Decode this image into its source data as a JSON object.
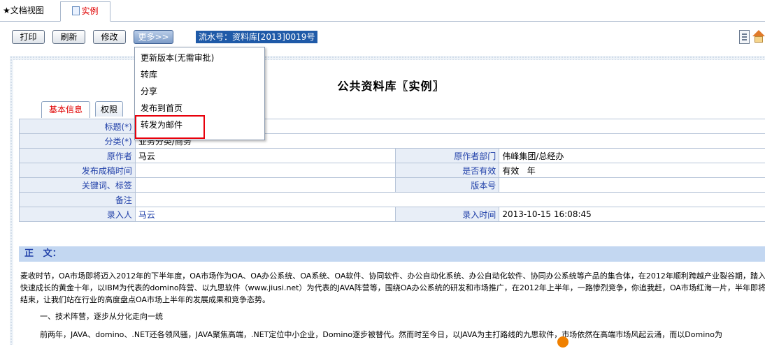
{
  "doc_tabs": {
    "view_label": "★文档视图",
    "example_label": "实例"
  },
  "toolbar": {
    "print_label": "打印",
    "refresh_label": "刷新",
    "edit_label": "修改",
    "more_label": "更多>>",
    "serial_label": "流水号：资料库[2013]0019号"
  },
  "more_menu": {
    "items": [
      "更新版本(无需审批)",
      "转库",
      "分享",
      "发布到首页",
      "转发为邮件"
    ],
    "highlighted": "转发为邮件"
  },
  "page": {
    "title": "公共资料库〖实例〗",
    "tabs": [
      "基本信息",
      "权限"
    ]
  },
  "fields": {
    "title_label": "标题(*)",
    "title_value": "",
    "category_label": "分类(*)",
    "category_value": "业务分类/商务",
    "author_label": "原作者",
    "author_value": "马云",
    "author_dept_label": "原作者部门",
    "author_dept_value": "伟峰集团/总经办",
    "publish_time_label": "发布成稿时间",
    "publish_time_value": "",
    "valid_label": "是否有效",
    "valid_value": "有效   年",
    "keywords_label": "关键词、标签",
    "keywords_value": "",
    "version_label": "版本号",
    "version_value": "",
    "remark_label": "备注",
    "remark_value": "",
    "entered_by_label": "录入人",
    "entered_by_value": "马云",
    "entered_time_label": "录入时间",
    "entered_time_value": "2013-10-15 16:08:45"
  },
  "body": {
    "header": "正   文：",
    "para1": "麦收时节，OA市场即将迈入2012年的下半年度，OA市场作为OA、OA办公系统、OA系统、OA软件、协同软件、办公自动化系统、办公自动化软件、协同办公系统等产品的集合体，在2012年顺利跨越产业裂谷期，踏入快速成长的黄金十年，以IBM为代表的domino阵营、以九思软件（www.jiusi.net）为代表的JAVA阵营等，围绕OA办公系统的研发和市场推广，在2012年上半年，一路惨烈竞争，你追我赶，OA市场红海一片，半年即将结束，让我们站在行业的高度盘点OA市场上半年的发展成果和竞争态势。",
    "para2": "一、技术阵营，逐步从分化走向一统",
    "para3": "前两年，JAVA、domino、.NET还各领风骚，JAVA聚焦高端，.NET定位中小企业，Domino逐步被替代。然而时至今日，以JAVA为主打路线的九思软件，市场依然在高端市场风起云涌，而以Domino为"
  },
  "colors": {
    "accent_blue": "#1f5aa8",
    "label_bg": "#e8eef7",
    "highlight_red": "#e8000b"
  }
}
